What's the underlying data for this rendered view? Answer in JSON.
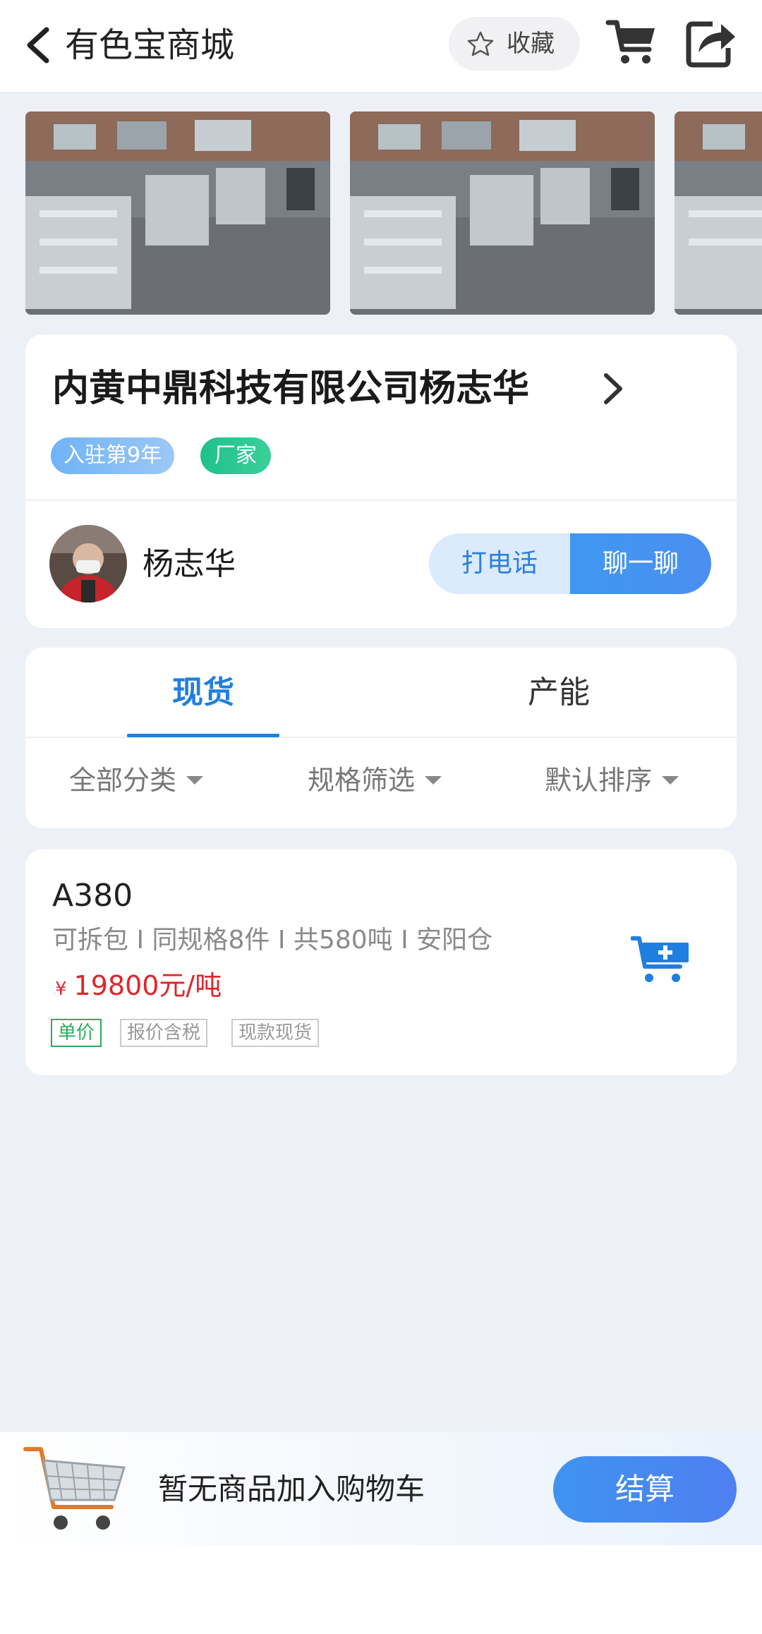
{
  "header": {
    "title": "有色宝商城",
    "favorite_label": "收藏",
    "icons": [
      "back-icon",
      "star-icon",
      "shopping-cart-icon",
      "share-icon"
    ]
  },
  "gallery": {
    "photo_count": 3
  },
  "company": {
    "name": "内黄中鼎科技有限公司杨志华",
    "tag_years": "入驻第9年",
    "tag_type": "厂家",
    "contact_name": "杨志华",
    "call_label": "打电话",
    "chat_label": "聊一聊"
  },
  "tabs": {
    "spot": "现货",
    "capacity": "产能",
    "active": "现货"
  },
  "filters": {
    "category": "全部分类",
    "spec": "规格筛选",
    "sort": "默认排序"
  },
  "product": {
    "name": "A380",
    "meta": "可拆包 I 同规格8件 I 共580吨 I 安阳仓",
    "currency": "¥",
    "price": "19800元/吨",
    "tags": [
      "单价",
      "报价含税",
      "现款现货"
    ]
  },
  "bottom_bar": {
    "empty_text": "暂无商品加入购物车",
    "checkout_label": "结算"
  },
  "colors": {
    "accent": "#1f7fe0",
    "price_red": "#e0252b",
    "tag_green": "#2bae5a",
    "background": "#eef0f7"
  }
}
